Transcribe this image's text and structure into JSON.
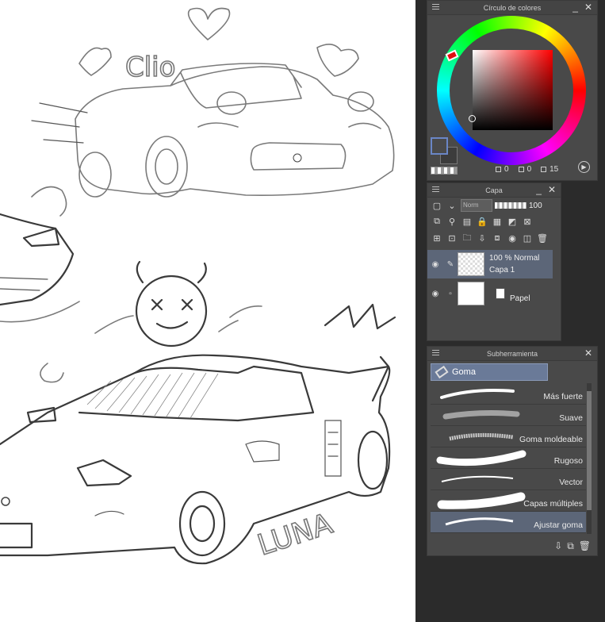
{
  "canvas": {
    "texts": [
      "Clio",
      "LUNA"
    ]
  },
  "color_panel": {
    "title": "Círculo de colores",
    "minimize": "_",
    "close": "✕",
    "values": {
      "h": "0",
      "s": "0",
      "v": "15"
    }
  },
  "layer_panel": {
    "title": "Capa",
    "minimize": "_",
    "close": "✕",
    "blend_mode": "Norm",
    "opacity": "100",
    "layers": [
      {
        "mode": "100 % Normal",
        "name": "Capa 1",
        "selected": true
      },
      {
        "name": "Papel",
        "selected": false
      }
    ]
  },
  "subtool_panel": {
    "title": "Subherramienta",
    "close": "✕",
    "active_tool": "Goma",
    "brushes": [
      {
        "label": "Más fuerte"
      },
      {
        "label": "Suave"
      },
      {
        "label": "Goma moldeable"
      },
      {
        "label": "Rugoso"
      },
      {
        "label": "Vector"
      },
      {
        "label": "Capas múltiples"
      },
      {
        "label": "Ajustar goma",
        "selected": true
      }
    ]
  },
  "colors": {
    "accent_selection": "#5c6678",
    "tool_tab": "#6a7a98",
    "panel_bg": "#494949"
  }
}
